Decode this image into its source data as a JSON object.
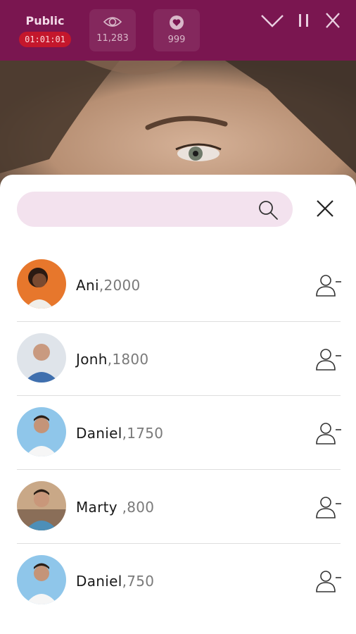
{
  "header": {
    "visibility_label": "Public",
    "timer": "01:01:01",
    "viewers": "11,283",
    "likes": "999"
  },
  "search": {
    "placeholder": ""
  },
  "users": [
    {
      "name": "Ani",
      "score": ",2000",
      "avatar_bg": "#e7772c"
    },
    {
      "name": "Jonh",
      "score": ",1800",
      "avatar_bg": "#dfe4ea"
    },
    {
      "name": "Daniel",
      "score": ",1750",
      "avatar_bg": "#8fc6ea"
    },
    {
      "name": "Marty ",
      "score": ",800",
      "avatar_bg": "#c9a887"
    },
    {
      "name": "Daniel",
      "score": ",750",
      "avatar_bg": "#8fc6ea"
    }
  ],
  "colors": {
    "header_bg": "#7a1650",
    "timer_bg": "#c4172c",
    "search_bg": "#f3e2ee"
  }
}
